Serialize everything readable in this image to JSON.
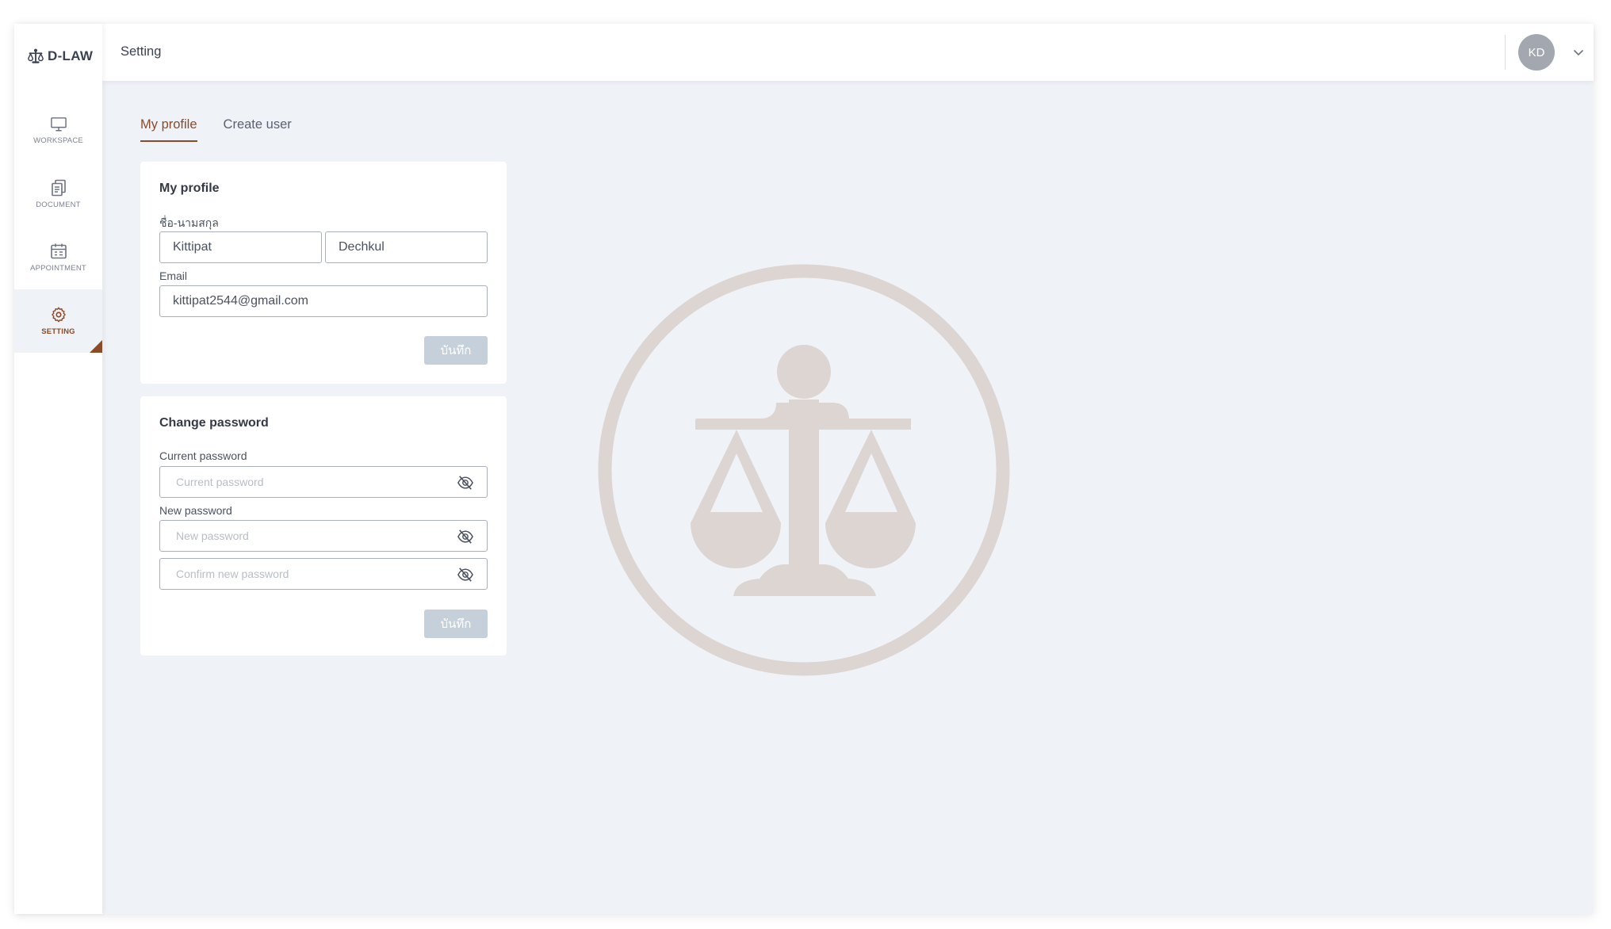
{
  "brand": {
    "name": "D-LAW"
  },
  "sidebar": {
    "items": [
      {
        "label": "WORKSPACE",
        "icon": "monitor-icon",
        "active": false
      },
      {
        "label": "DOCUMENT",
        "icon": "documents-icon",
        "active": false
      },
      {
        "label": "APPOINTMENT",
        "icon": "calendar-icon",
        "active": false
      },
      {
        "label": "SETTING",
        "icon": "gear-icon",
        "active": true
      }
    ]
  },
  "header": {
    "title": "Setting",
    "avatar_initials": "KD"
  },
  "tabs": [
    {
      "label": "My profile",
      "active": true
    },
    {
      "label": "Create user",
      "active": false
    }
  ],
  "profile": {
    "title": "My profile",
    "name_label": "ชื่อ-นามสกุล",
    "first_name": "Kittipat",
    "last_name": "Dechkul",
    "email_label": "Email",
    "email": "kittipat2544@gmail.com",
    "save_label": "บันทึก"
  },
  "password": {
    "title": "Change password",
    "current_label": "Current password",
    "current_placeholder": "Current password",
    "new_label": "New password",
    "new_placeholder": "New password",
    "confirm_placeholder": "Confirm new password",
    "save_label": "บันทึก"
  },
  "colors": {
    "accent": "#8b4a28",
    "background": "#eff3f8",
    "button_disabled": "#c6d0db",
    "emblem": "#ddd5d2"
  }
}
